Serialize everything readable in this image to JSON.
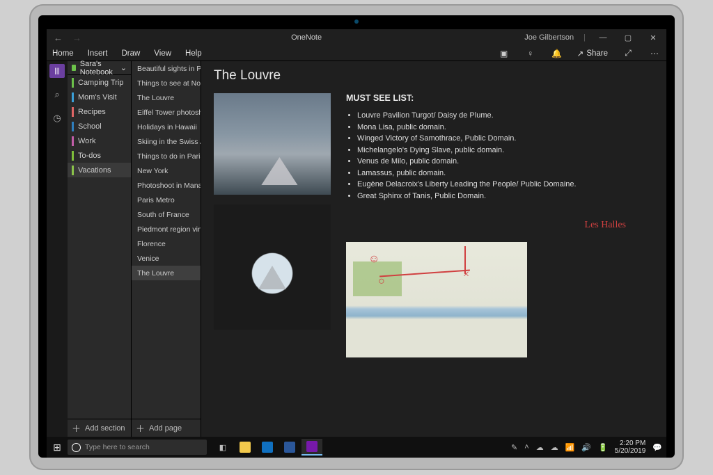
{
  "app": {
    "title": "OneNote",
    "user": "Joe Gilbertson"
  },
  "ribbon": {
    "tabs": [
      "Home",
      "Insert",
      "Draw",
      "View",
      "Help"
    ],
    "share_label": "Share"
  },
  "notebook": {
    "name": "Sara's Notebook"
  },
  "sections": [
    {
      "label": "Camping Trip",
      "color": "#6cc24a"
    },
    {
      "label": "Mom's Visit",
      "color": "#3aa0d8"
    },
    {
      "label": "Recipes",
      "color": "#e06666"
    },
    {
      "label": "School",
      "color": "#2e7fbf"
    },
    {
      "label": "Work",
      "color": "#c25da8"
    },
    {
      "label": "To-dos",
      "color": "#7fbf3a"
    },
    {
      "label": "Vacations",
      "color": "#8bc34a",
      "selected": true
    }
  ],
  "pages": [
    "Beautiful sights in Paris",
    "Things to see at Notre…",
    "The Louvre",
    "Eiffel Tower photoshoot",
    "Holidays in Hawaii",
    "Skiing in the Swiss Alps",
    "Things to do in Paris",
    "New York",
    "Photoshoot in Manarola",
    "Paris Metro",
    "South of France",
    "Piedmont region viney…",
    "Florence",
    "Venice",
    "The Louvre"
  ],
  "pages_selected_index": 14,
  "add_section": "Add section",
  "add_page": "Add page",
  "content": {
    "title": "The Louvre",
    "must_see_heading": "MUST SEE LIST:",
    "must_see": [
      "Louvre Pavilion Turgot/ Daisy de Plume.",
      "Mona Lisa, public domain.",
      "Winged Victory of Samothrace, Public Domain.",
      "Michelangelo's Dying Slave, public domain.",
      "Venus de Milo, public domain.",
      "Lamassus, public domain.",
      "Eugène Delacroix's Liberty Leading the People/ Public Domaine.",
      "Great Sphinx of Tanis, Public Domain."
    ],
    "ink_annotation": "Les Halles"
  },
  "taskbar": {
    "search_placeholder": "Type here to search",
    "time": "2:20 PM",
    "date": "5/20/2019"
  },
  "colors": {
    "bg": "#1f1f1f",
    "panel": "#2a2a2a",
    "accent_purple": "#6b3fa0",
    "ink_red": "#d04040"
  }
}
